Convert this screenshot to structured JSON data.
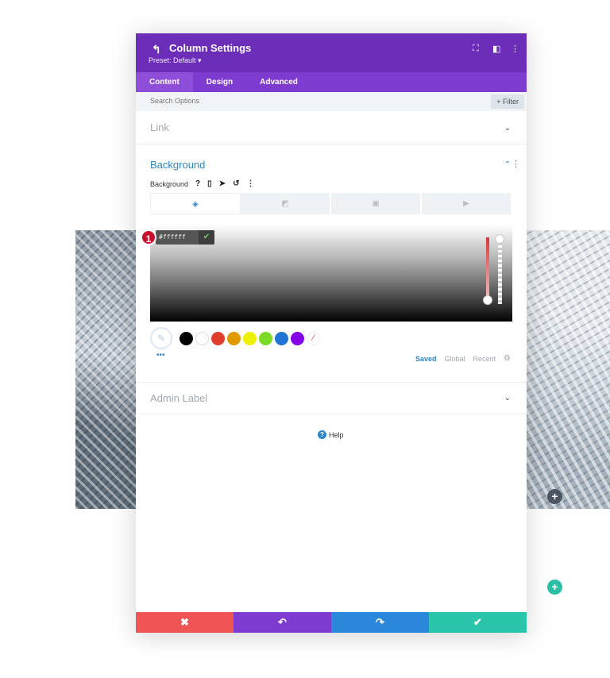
{
  "modal": {
    "title": "Column Settings",
    "preset": "Preset: Default ▾",
    "icons": {
      "back": "back-arrow-icon",
      "fullscreen": "fullscreen-icon",
      "split": "split-view-icon",
      "more": "more-vertical-icon"
    }
  },
  "tabs": [
    "Content",
    "Design",
    "Advanced"
  ],
  "active_tab": "Content",
  "search": {
    "placeholder": "Search Options",
    "filter_label": "+ Filter"
  },
  "sections": {
    "link": {
      "title": "Link"
    },
    "background": {
      "title": "Background",
      "field_label": "Background",
      "tool_icons": [
        "help-icon",
        "mobile-icon",
        "pointer-icon",
        "reset-icon",
        "more-vertical-icon"
      ],
      "type_tabs": [
        "color-fill-icon",
        "gradient-icon",
        "image-icon",
        "video-icon"
      ],
      "color_picker": {
        "hex_value": "#ffffff",
        "step_number": "1",
        "swatches": [
          "#000000",
          "#ffffff",
          "#e03e2d",
          "#e09a00",
          "#edf100",
          "#7cda24",
          "#1f74d6",
          "#8300e9"
        ],
        "palette_tabs": [
          "Saved",
          "Global",
          "Recent"
        ],
        "active_palette": "Saved"
      }
    },
    "admin_label": {
      "title": "Admin Label"
    }
  },
  "help_label": "Help",
  "footer": {
    "cancel_icon": "close-icon",
    "undo_icon": "undo-icon",
    "redo_icon": "redo-icon",
    "save_icon": "check-icon"
  },
  "colors": {
    "header": "#6c2eb9",
    "tabs": "#7e3bd0",
    "accent": "#2e86c8",
    "cancel": "#ef5555",
    "undo": "#7e3bd0",
    "redo": "#2b87da",
    "save": "#29c4a9"
  }
}
